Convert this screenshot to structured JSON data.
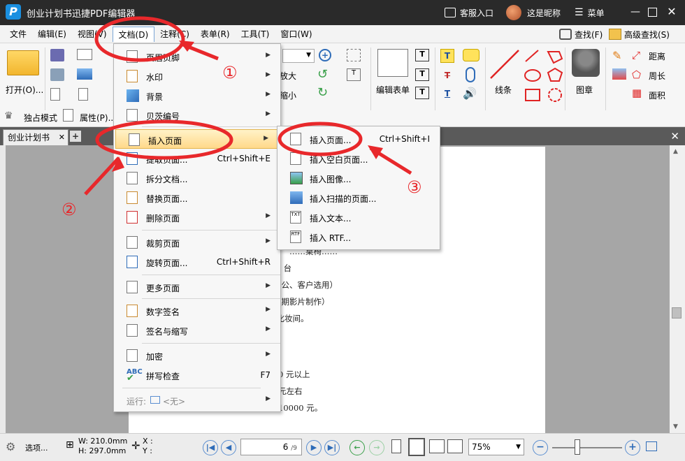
{
  "app": {
    "title": "创业计划书迅捷PDF编辑器",
    "logo_letter": "P"
  },
  "titlebar": {
    "support": "客服入口",
    "user": "这是昵称",
    "menu": "菜单"
  },
  "menubar": {
    "items": [
      "文件",
      "编辑(E)",
      "视图(V)",
      "文档(D)",
      "注释(C)",
      "表单(R)",
      "工具(T)",
      "窗口(W)"
    ],
    "right": [
      "查找(F)",
      "高级查找(S)"
    ]
  },
  "ribbon": {
    "open": "打开(O)...",
    "exclusive": "独占模式",
    "properties": "属性(P)...",
    "zoom_in": "放大",
    "zoom_out": "缩小",
    "edit_form": "编辑表单",
    "lines": "线条",
    "stamp": "图章",
    "distance": "距离",
    "perimeter": "周长",
    "area": "面积"
  },
  "tabs": {
    "doc": "创业计划书"
  },
  "document": {
    "lines": [
      "……桌椅……",
      "真机 2 台",
      "用于办公、客户选用）",
      "用于后期影片制作）",
      "、化妆间。",
      "0 元以上",
      "元左右",
      "10000 元。"
    ]
  },
  "doc_menu": {
    "items": [
      {
        "label": "页眉页脚",
        "arrow": true
      },
      {
        "label": "水印",
        "arrow": true
      },
      {
        "label": "背景",
        "arrow": true
      },
      {
        "label": "贝茨编号",
        "arrow": true
      },
      {
        "label": "插入页面",
        "arrow": true,
        "highlight": true
      },
      {
        "label": "提取页面...",
        "shortcut": "Ctrl+Shift+E"
      },
      {
        "label": "拆分文档..."
      },
      {
        "label": "替换页面..."
      },
      {
        "label": "删除页面",
        "arrow": true
      },
      {
        "label": "裁剪页面",
        "arrow": true
      },
      {
        "label": "旋转页面...",
        "shortcut": "Ctrl+Shift+R"
      },
      {
        "label": "更多页面",
        "arrow": true
      },
      {
        "label": "数字签名",
        "arrow": true
      },
      {
        "label": "签名与缩写",
        "arrow": true
      },
      {
        "label": "加密",
        "arrow": true
      },
      {
        "label": "拼写检查",
        "shortcut": "F7"
      },
      {
        "label": "运行:",
        "value": "<无>",
        "arrow": true,
        "disabled": true
      }
    ]
  },
  "insert_menu": {
    "items": [
      {
        "label": "插入页面...",
        "shortcut": "Ctrl+Shift+I"
      },
      {
        "label": "插入空白页面..."
      },
      {
        "label": "插入图像..."
      },
      {
        "label": "插入扫描的页面..."
      },
      {
        "label": "插入文本..."
      },
      {
        "label": "插入 RTF..."
      }
    ]
  },
  "annotations": {
    "step1": "①",
    "step2": "②",
    "step3": "③",
    "color": "#e8282b"
  },
  "statusbar": {
    "options": "选项...",
    "width": "W: 210.0mm",
    "height": "H: 297.0mm",
    "x": "X :",
    "y": "Y :",
    "page_current": "6",
    "page_total": "9",
    "zoom": "75%"
  },
  "colors": {
    "accent": "#2f6cb8",
    "highlight": "#ffd98a",
    "titlebar": "#2a2a2a"
  }
}
